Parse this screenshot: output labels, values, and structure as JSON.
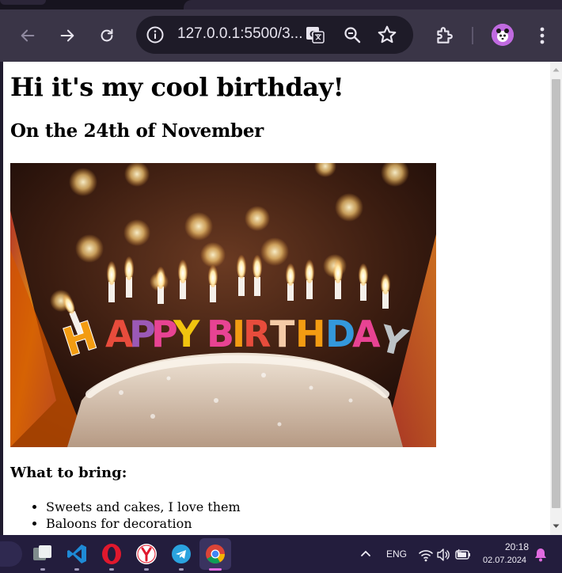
{
  "browser": {
    "url": "127.0.0.1:5500/3...",
    "accent": "#3a3547",
    "profile_color": "#c06ae0"
  },
  "page": {
    "title": "Hi it's my cool birthday!",
    "subtitle": "On the 24th of November",
    "image_alt": "HAPPY BIRTHDAY",
    "bring_heading": "What to bring:",
    "bring_items": [
      "Sweets and cakes, I love them",
      "Baloons for decoration"
    ]
  },
  "taskbar": {
    "apps": [
      "file-explorer-icon",
      "vscode-icon",
      "opera-icon",
      "yandex-icon",
      "telegram-icon",
      "chrome-icon"
    ],
    "language": "ENG",
    "time": "20:18",
    "date": "02.07.2024"
  }
}
